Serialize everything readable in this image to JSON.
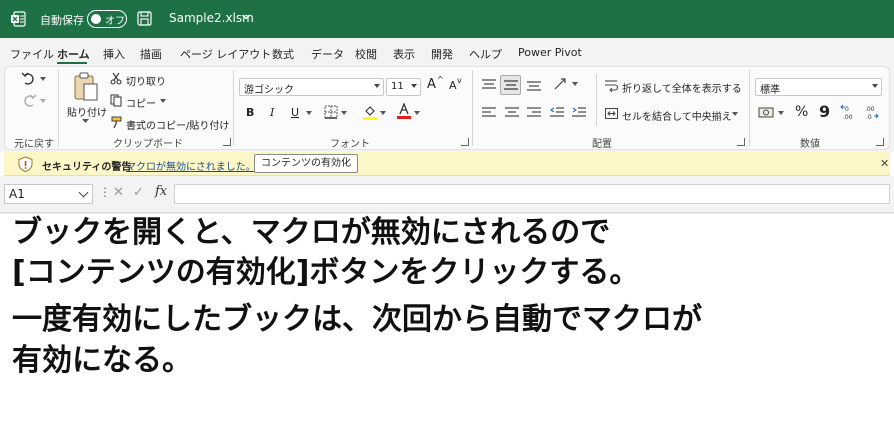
{
  "titlebar": {
    "autosave_label": "自動保存",
    "autosave_state": "オフ",
    "document_title": "Sample2.xlsm",
    "brand_color": "#1e7145"
  },
  "menu": {
    "tabs": [
      "ファイル",
      "ホーム",
      "挿入",
      "描画",
      "ページ レイアウト",
      "数式",
      "データ",
      "校閲",
      "表示",
      "開発",
      "ヘルプ",
      "Power Pivot"
    ],
    "active": "ホーム"
  },
  "ribbon": {
    "undo_group": "元に戻す",
    "clipboard": {
      "label": "クリップボード",
      "paste": "貼り付け",
      "cut": "切り取り",
      "copy": "コピー",
      "format_painter": "書式のコピー/貼り付け"
    },
    "font": {
      "label": "フォント",
      "name": "游ゴシック",
      "size": "11",
      "grow": "A",
      "shrink": "A",
      "bold": "B",
      "italic": "I",
      "underline": "U",
      "highlight_color": "#ffff00",
      "font_color": "#e02020"
    },
    "alignment": {
      "label": "配置",
      "wrap_text": "折り返して全体を表示する",
      "merge_center": "セルを結合して中央揃え"
    },
    "number": {
      "label": "数値",
      "format": "標準",
      "percent": "%",
      "comma": "9"
    }
  },
  "security_bar": {
    "title": "セキュリティの警告",
    "message": "マクロが無効にされました。",
    "enable_button": "コンテンツの有効化"
  },
  "formula_bar": {
    "name_box": "A1",
    "fx": "fx",
    "formula": ""
  },
  "overlay_text": [
    "ブックを開くと、マクロが無効にされるので",
    "[コンテンツの有効化]ボタンをクリックする。",
    "一度有効にしたブックは、次回から自動でマクロが",
    "有効になる。"
  ]
}
